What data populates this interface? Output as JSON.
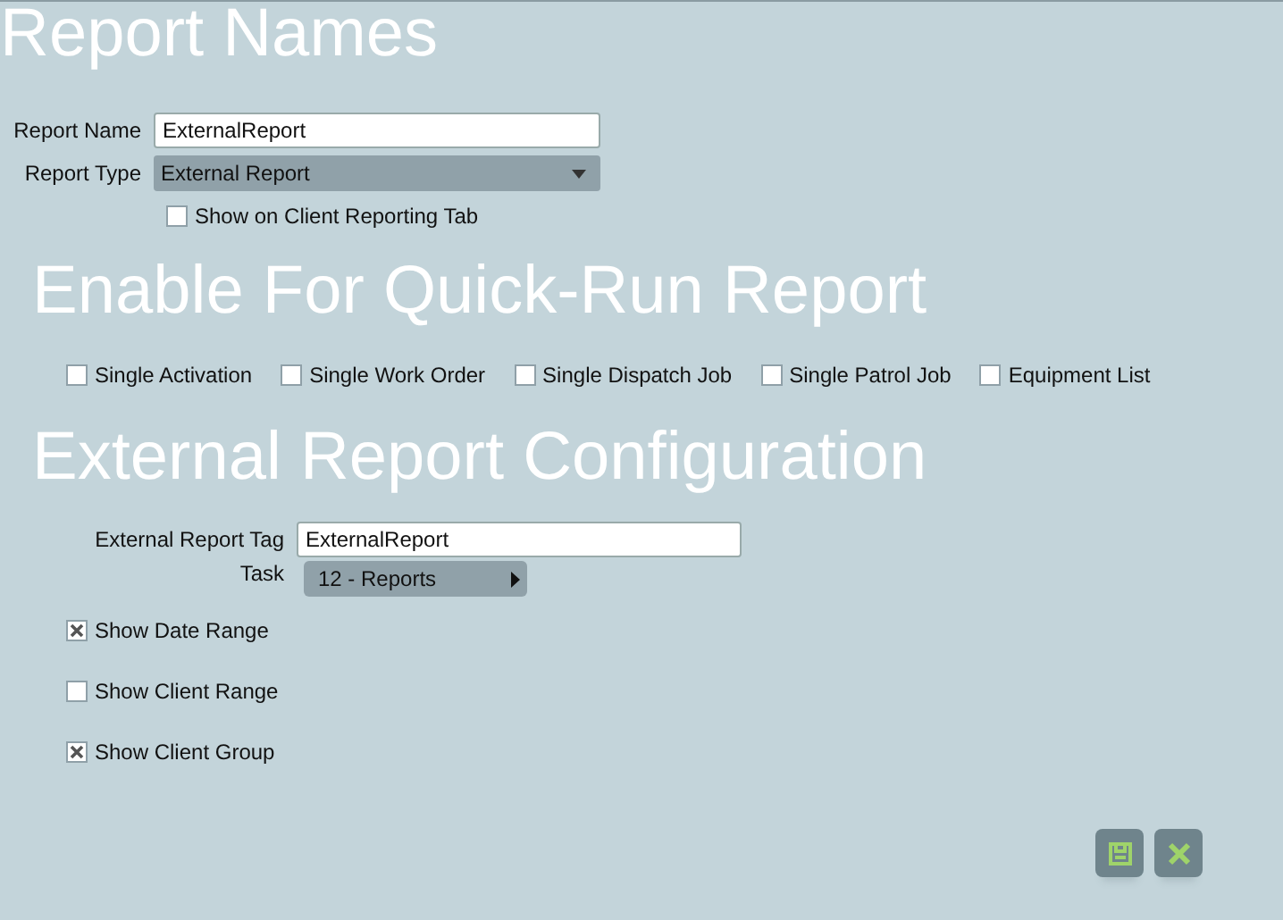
{
  "sections": [
    {
      "title": "Report Names"
    },
    {
      "title": "Enable For Quick-Run Report"
    },
    {
      "title": "External Report Configuration"
    }
  ],
  "report_name": {
    "label": "Report Name",
    "value": "ExternalReport"
  },
  "report_type": {
    "label": "Report Type",
    "value": "External Report"
  },
  "show_on_client_tab": {
    "label": "Show on Client Reporting Tab",
    "checked": false
  },
  "quick_run": [
    {
      "label": "Single Activation",
      "checked": false
    },
    {
      "label": "Single Work Order",
      "checked": false
    },
    {
      "label": "Single Dispatch Job",
      "checked": false
    },
    {
      "label": "Single Patrol Job",
      "checked": false
    },
    {
      "label": "Equipment List",
      "checked": false
    }
  ],
  "external_tag": {
    "label": "External Report Tag",
    "value": "ExternalReport"
  },
  "task": {
    "label": "Task",
    "value": "12 - Reports"
  },
  "options": [
    {
      "label": "Show Date Range",
      "checked": true
    },
    {
      "label": "Show Client Range",
      "checked": false
    },
    {
      "label": "Show Client Group",
      "checked": true
    }
  ],
  "actions": [
    {
      "kind": "save"
    },
    {
      "kind": "cancel"
    }
  ]
}
